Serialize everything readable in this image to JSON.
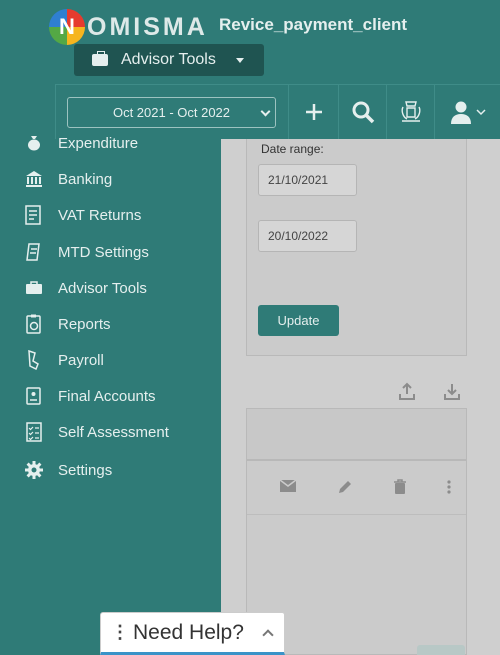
{
  "header": {
    "logo_text": "OMISMA",
    "logo_letter": "N",
    "client_name": "Revice_payment_client",
    "tools_label": "Advisor Tools",
    "date_range_select": "Oct 2021 - Oct 2022"
  },
  "sidebar": {
    "items": [
      {
        "label": "Expenditure",
        "icon": "money-bag-icon"
      },
      {
        "label": "Banking",
        "icon": "bank-icon"
      },
      {
        "label": "VAT Returns",
        "icon": "vat-doc-icon"
      },
      {
        "label": "MTD Settings",
        "icon": "receipt-icon"
      },
      {
        "label": "Advisor Tools",
        "icon": "briefcase-icon"
      },
      {
        "label": "Reports",
        "icon": "report-icon"
      },
      {
        "label": "Payroll",
        "icon": "payroll-icon"
      },
      {
        "label": "Final Accounts",
        "icon": "accounts-book-icon"
      },
      {
        "label": "Self Assessment",
        "icon": "checklist-icon"
      },
      {
        "label": "Settings",
        "icon": "gear-icon"
      }
    ]
  },
  "filter": {
    "date_range_label": "Date range:",
    "start_date": "21/10/2021",
    "end_date": "20/10/2022",
    "update_label": "Update"
  },
  "help": {
    "label": "Need Help?"
  },
  "colors": {
    "primary": "#2f7b77",
    "dark": "#1f5451",
    "overlay": "#cbcbcb"
  }
}
